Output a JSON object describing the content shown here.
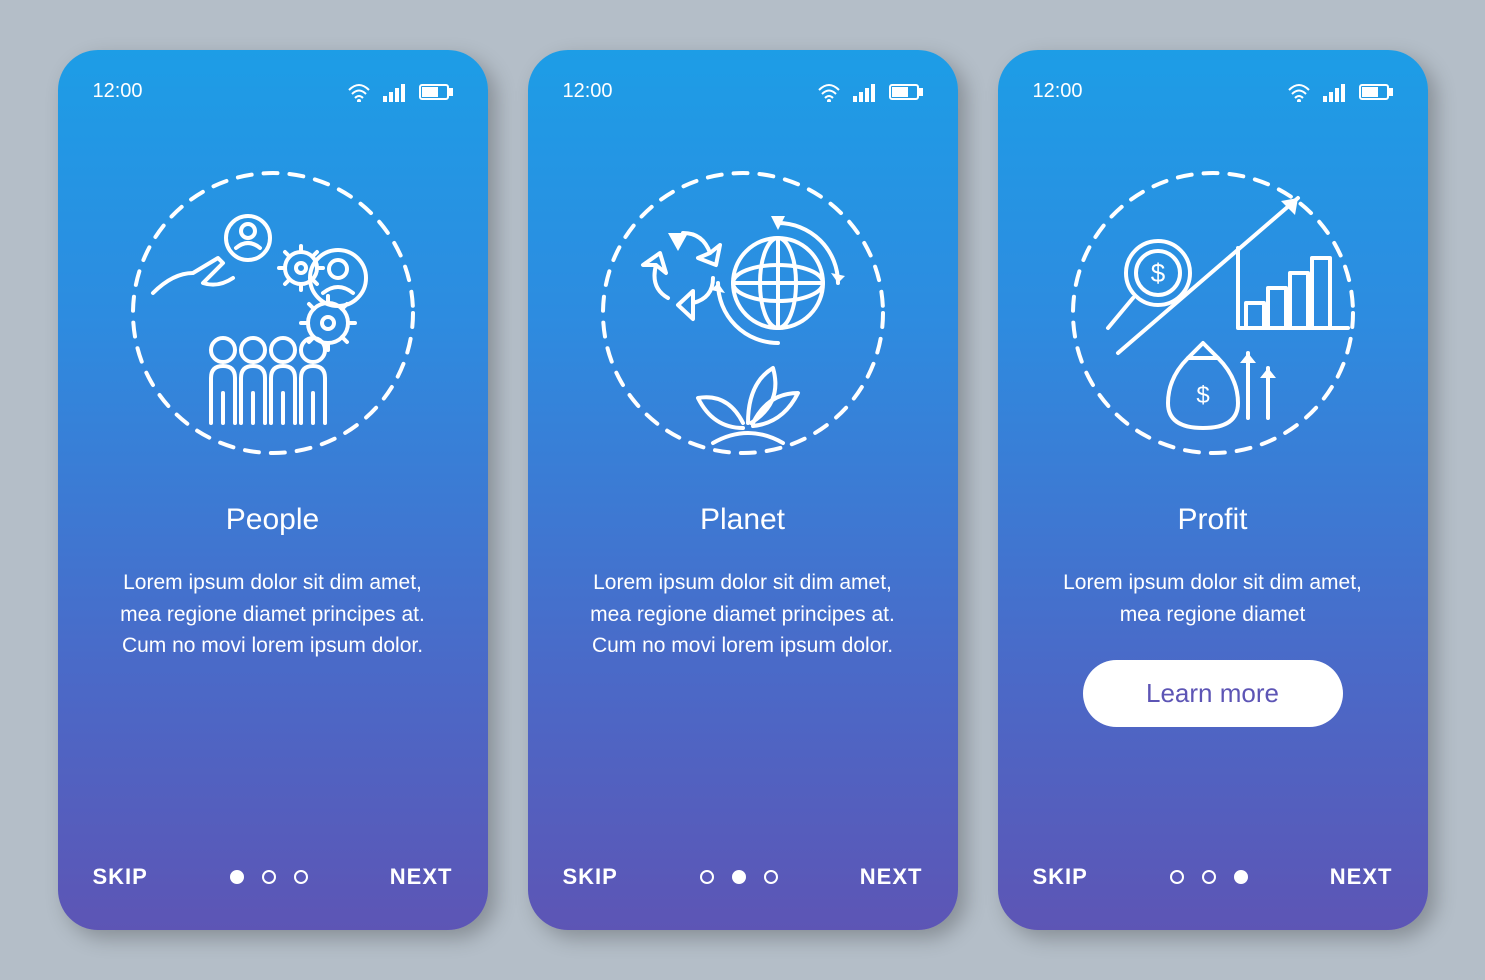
{
  "status": {
    "time": "12:00"
  },
  "nav": {
    "skip": "SKIP",
    "next": "NEXT"
  },
  "screens": [
    {
      "title": "People",
      "body": "Lorem ipsum dolor sit dim amet, mea regione diamet principes at. Cum no movi lorem ipsum dolor.",
      "cta": null,
      "active_dot": 0
    },
    {
      "title": "Planet",
      "body": "Lorem ipsum dolor sit dim amet, mea regione diamet principes at. Cum no movi lorem ipsum dolor.",
      "cta": null,
      "active_dot": 1
    },
    {
      "title": "Profit",
      "body": "Lorem ipsum dolor sit dim amet, mea regione diamet",
      "cta": "Learn more",
      "active_dot": 2
    }
  ]
}
